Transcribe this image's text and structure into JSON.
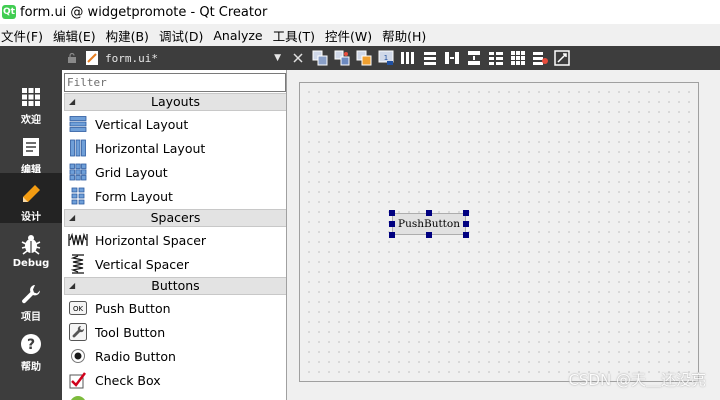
{
  "window": {
    "title": "form.ui @ widgetpromote - Qt Creator",
    "app_icon": "qt-creator-icon"
  },
  "menubar": [
    {
      "label": "文件(F)"
    },
    {
      "label": "编辑(E)"
    },
    {
      "label": "构建(B)"
    },
    {
      "label": "调试(D)"
    },
    {
      "label": "Analyze"
    },
    {
      "label": "工具(T)"
    },
    {
      "label": "控件(W)"
    },
    {
      "label": "帮助(H)"
    }
  ],
  "modes": [
    {
      "label": "欢迎",
      "icon": "grid-icon",
      "active": false
    },
    {
      "label": "编辑",
      "icon": "document-icon",
      "active": false
    },
    {
      "label": "设计",
      "icon": "pencil-icon",
      "active": true
    },
    {
      "label": "Debug",
      "icon": "bug-icon",
      "active": false
    },
    {
      "label": "项目",
      "icon": "wrench-icon",
      "active": false
    },
    {
      "label": "帮助",
      "icon": "help-icon",
      "active": false
    }
  ],
  "editor": {
    "file_name": "form.ui*"
  },
  "widget_box": {
    "filter_placeholder": "Filter",
    "categories": [
      {
        "title": "Layouts",
        "items": [
          {
            "label": "Vertical Layout",
            "icon": "vertical-layout-icon"
          },
          {
            "label": "Horizontal Layout",
            "icon": "horizontal-layout-icon"
          },
          {
            "label": "Grid Layout",
            "icon": "grid-layout-icon"
          },
          {
            "label": "Form Layout",
            "icon": "form-layout-icon"
          }
        ]
      },
      {
        "title": "Spacers",
        "items": [
          {
            "label": "Horizontal Spacer",
            "icon": "horizontal-spacer-icon"
          },
          {
            "label": "Vertical Spacer",
            "icon": "vertical-spacer-icon"
          }
        ]
      },
      {
        "title": "Buttons",
        "items": [
          {
            "label": "Push Button",
            "icon": "push-button-icon"
          },
          {
            "label": "Tool Button",
            "icon": "tool-button-icon"
          },
          {
            "label": "Radio Button",
            "icon": "radio-button-icon"
          },
          {
            "label": "Check Box",
            "icon": "check-box-icon"
          }
        ]
      }
    ]
  },
  "form": {
    "push_button_text": "PushButton"
  },
  "watermark": "CSDN @天＿还没亮",
  "colors": {
    "mode_bar": "#3d3d3d",
    "mode_active": "#232323",
    "selection_handle": "#000080"
  }
}
